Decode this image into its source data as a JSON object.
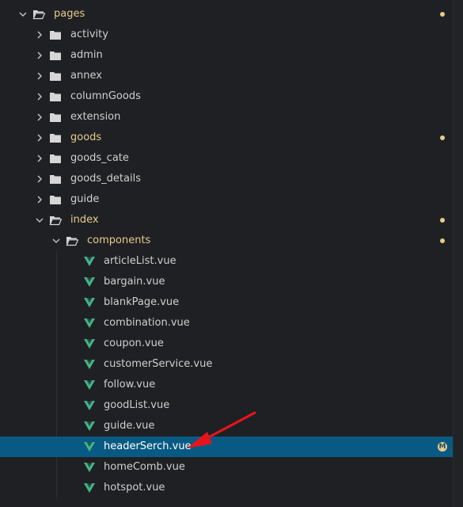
{
  "tree": {
    "root": {
      "label": "pages",
      "modified": true
    },
    "folders": [
      {
        "label": "activity",
        "modified": false
      },
      {
        "label": "admin",
        "modified": false
      },
      {
        "label": "annex",
        "modified": false
      },
      {
        "label": "columnGoods",
        "modified": false
      },
      {
        "label": "extension",
        "modified": false
      },
      {
        "label": "goods",
        "modified": true
      },
      {
        "label": "goods_cate",
        "modified": false
      },
      {
        "label": "goods_details",
        "modified": false
      },
      {
        "label": "guide",
        "modified": false
      }
    ],
    "index": {
      "label": "index",
      "modified": true
    },
    "components": {
      "label": "components",
      "modified": true
    },
    "files": [
      {
        "label": "articleList.vue"
      },
      {
        "label": "bargain.vue"
      },
      {
        "label": "blankPage.vue"
      },
      {
        "label": "combination.vue"
      },
      {
        "label": "coupon.vue"
      },
      {
        "label": "customerService.vue"
      },
      {
        "label": "follow.vue"
      },
      {
        "label": "goodList.vue"
      },
      {
        "label": "guide.vue"
      },
      {
        "label": "headerSerch.vue",
        "selected": true,
        "badge": "M"
      },
      {
        "label": "homeComb.vue"
      },
      {
        "label": "hotspot.vue"
      }
    ]
  },
  "colors": {
    "background": "#1f2023",
    "selected_row": "#095a83",
    "modified_text": "#e6cc8a",
    "vue_green": "#41b883",
    "arrow_red": "#e8141c"
  }
}
